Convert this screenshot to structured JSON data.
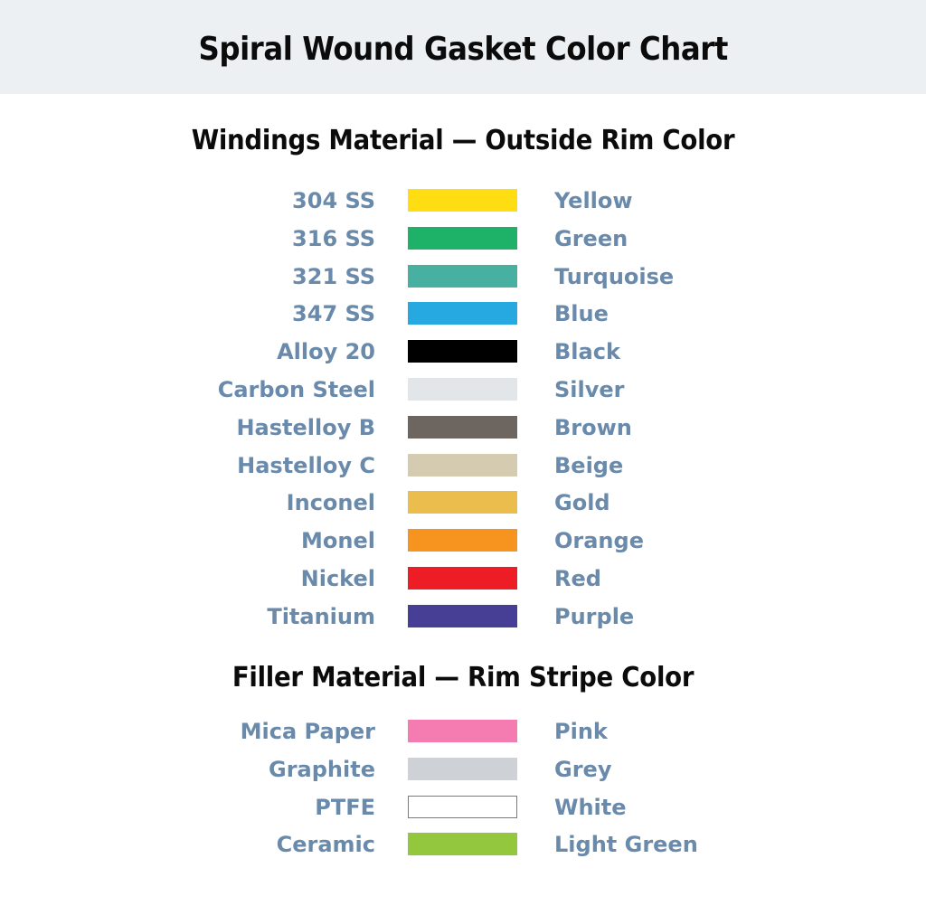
{
  "title": "Spiral Wound Gasket Color Chart",
  "sections": [
    {
      "heading": "Windings Material — Outside Rim Color",
      "rows": [
        {
          "material": "304 SS",
          "color_name": "Yellow",
          "color": "#fedd13"
        },
        {
          "material": "316 SS",
          "color_name": "Green",
          "color": "#1db267"
        },
        {
          "material": "321 SS",
          "color_name": "Turquoise",
          "color": "#48b0a0"
        },
        {
          "material": "347 SS",
          "color_name": "Blue",
          "color": "#26a8e0"
        },
        {
          "material": "Alloy 20",
          "color_name": "Black",
          "color": "#000000"
        },
        {
          "material": "Carbon Steel",
          "color_name": "Silver",
          "color": "#e3e6e9"
        },
        {
          "material": "Hastelloy B",
          "color_name": "Brown",
          "color": "#6c6560"
        },
        {
          "material": "Hastelloy C",
          "color_name": "Beige",
          "color": "#d4cbb0"
        },
        {
          "material": "Inconel",
          "color_name": "Gold",
          "color": "#eabd4d"
        },
        {
          "material": "Monel",
          "color_name": "Orange",
          "color": "#f7941f"
        },
        {
          "material": "Nickel",
          "color_name": "Red",
          "color": "#ed1c25"
        },
        {
          "material": "Titanium",
          "color_name": "Purple",
          "color": "#463f95"
        }
      ]
    },
    {
      "heading": "Filler Material — Rim Stripe Color",
      "rows": [
        {
          "material": "Mica Paper",
          "color_name": "Pink",
          "color": "#f47cb0"
        },
        {
          "material": "Graphite",
          "color_name": "Grey",
          "color": "#ced2d6"
        },
        {
          "material": "PTFE",
          "color_name": "White",
          "color": "#ffffff"
        },
        {
          "material": "Ceramic",
          "color_name": "Light Green",
          "color": "#93c83e"
        }
      ]
    }
  ]
}
